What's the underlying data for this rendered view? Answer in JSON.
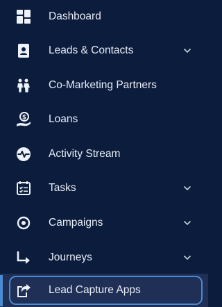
{
  "colors": {
    "background": "#0b1c3d",
    "text": "#e9edf5",
    "icon": "#eef1f7",
    "active_background": "#1f2f56",
    "active_outline": "#4a8ad3"
  },
  "nav": {
    "items": [
      {
        "label": "Dashboard",
        "icon": "dashboard-icon",
        "has_chevron": false,
        "active": false
      },
      {
        "label": "Leads & Contacts",
        "icon": "contacts-book-icon",
        "has_chevron": true,
        "active": false
      },
      {
        "label": "Co-Marketing Partners",
        "icon": "partners-icon",
        "has_chevron": false,
        "active": false
      },
      {
        "label": "Loans",
        "icon": "loan-icon",
        "has_chevron": false,
        "active": false
      },
      {
        "label": "Activity Stream",
        "icon": "activity-pulse-icon",
        "has_chevron": false,
        "active": false
      },
      {
        "label": "Tasks",
        "icon": "tasks-calendar-icon",
        "has_chevron": true,
        "active": false
      },
      {
        "label": "Campaigns",
        "icon": "campaign-target-icon",
        "has_chevron": true,
        "active": false
      },
      {
        "label": "Journeys",
        "icon": "journey-arrow-icon",
        "has_chevron": true,
        "active": false
      },
      {
        "label": "Lead Capture Apps",
        "icon": "lead-capture-icon",
        "has_chevron": false,
        "active": true
      }
    ]
  }
}
